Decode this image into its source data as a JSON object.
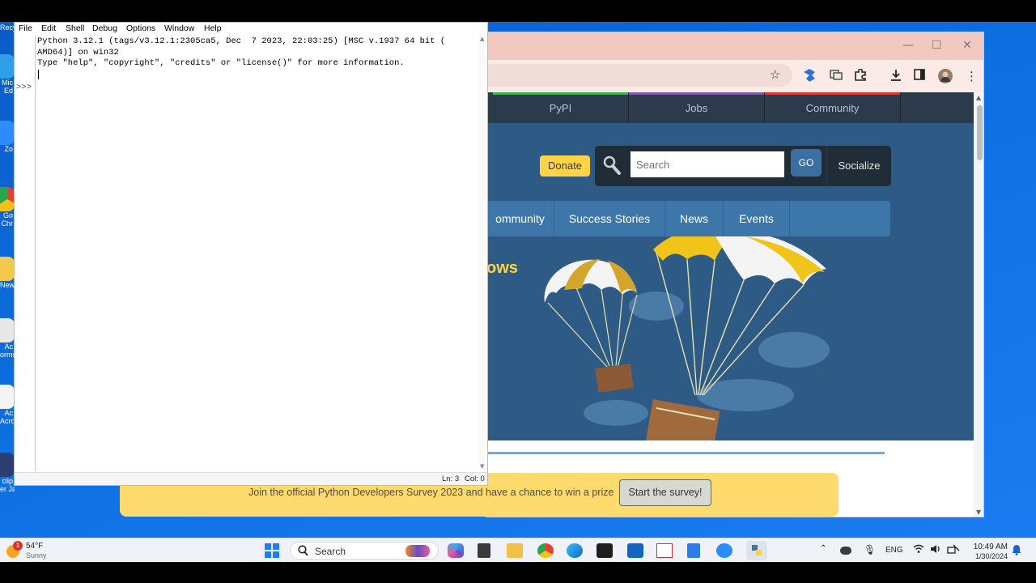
{
  "desktop": {
    "icons": [
      {
        "label": "Recy",
        "color": "#9fb5c9"
      },
      {
        "label": "Mic",
        "label2": "Ed",
        "color": "#2e9ee6"
      },
      {
        "label": "Zo",
        "color": "#2d8cff"
      },
      {
        "label": "Go",
        "label2": "Chr",
        "color": "#e34133"
      },
      {
        "label": "New",
        "color": "#f2c94c"
      },
      {
        "label": "Ac",
        "label2": "orms",
        "color": "#e8e8e8"
      },
      {
        "label": "Ac",
        "label2": "Acro",
        "color": "#d9534f"
      },
      {
        "label": "clip",
        "label2": "er Ja",
        "color": "#2c3e70"
      }
    ]
  },
  "idle": {
    "menu": [
      "File",
      "Edit",
      "Shell",
      "Debug",
      "Options",
      "Window",
      "Help"
    ],
    "banner_line1": "Python 3.12.1 (tags/v3.12.1:2305ca5, Dec  7 2023, 22:03:25) [MSC v.1937 64 bit (",
    "banner_line2": "AMD64)] on win32",
    "banner_line3": "Type \"help\", \"copyright\", \"credits\" or \"license()\" for more information.",
    "prompt": ">>>",
    "status_line": "Ln: 3",
    "status_col": "Col: 0"
  },
  "chrome": {
    "window_controls": {
      "minimize": "—",
      "maximize": "☐",
      "close": "✕"
    },
    "toolbar_icons": [
      "star-icon",
      "extension-icon",
      "translate-icon",
      "puzzle-icon",
      "download-icon",
      "sidepanel-icon",
      "profile-avatar",
      "kebab-menu-icon"
    ]
  },
  "python_site": {
    "topnav": [
      {
        "label": "PyPI",
        "accent": "#3fb34f"
      },
      {
        "label": "Jobs",
        "accent": "#7b5ea7"
      },
      {
        "label": "Community",
        "accent": "#d93a3a"
      }
    ],
    "donate": "Donate",
    "search_placeholder": "Search",
    "go": "GO",
    "socialize": "Socialize",
    "mainnav": [
      "ommunity",
      "Success Stories",
      "News",
      "Events"
    ],
    "hero_fragment": "ows"
  },
  "survey": {
    "text": "Join the official Python Developers Survey 2023 and have a chance to win a prize",
    "button": "Start the survey!"
  },
  "taskbar": {
    "weather_temp": "54°F",
    "weather_desc": "Sunny",
    "weather_badge": "1",
    "search": "Search",
    "lang": "ENG",
    "time": "10:49 AM",
    "date": "1/30/2024"
  }
}
